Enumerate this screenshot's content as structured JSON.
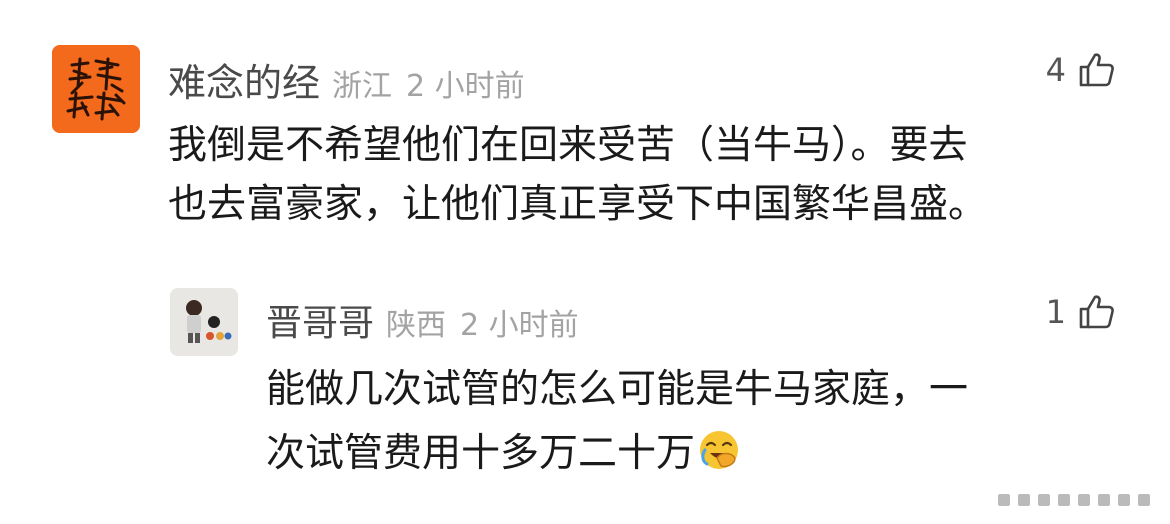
{
  "main_comment": {
    "username": "难念的经",
    "region": "浙江",
    "time": "2 小时前",
    "likes": "4",
    "lines": [
      "我倒是不希望他们在回来受苦（当牛马）。要去",
      "也去富豪家，让他们真正享受下中国繁华昌盛。"
    ]
  },
  "reply": {
    "username": "晋哥哥",
    "region": "陕西",
    "time": "2 小时前",
    "likes": "1",
    "lines": [
      "能做几次试管的怎么可能是牛马家庭，一",
      "次试管费用十多万二十万"
    ],
    "emoji": "face-palm-laughing-emoji"
  },
  "colors": {
    "username": "#4a4a4a",
    "meta": "#a3a3a3",
    "text": "#1a1a1a",
    "avatar_main_bg": "#f36a1c"
  }
}
